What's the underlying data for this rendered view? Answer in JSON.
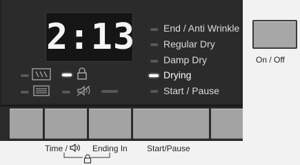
{
  "display": {
    "time": "2:13"
  },
  "status_list": [
    {
      "label": "End / Anti Wrinkle",
      "on": false
    },
    {
      "label": "Regular Dry",
      "on": false
    },
    {
      "label": "Damp Dry",
      "on": false
    },
    {
      "label": "Drying",
      "on": true
    },
    {
      "label": "Start / Pause",
      "on": false
    }
  ],
  "option_icons": [
    {
      "icon": "dry-level-icon",
      "on": false
    },
    {
      "icon": "child-lock-icon",
      "on": true
    },
    {
      "icon": "filter-icon",
      "on": false
    },
    {
      "icon": "sound-off-icon",
      "on": false
    }
  ],
  "buttons": {
    "time_sound_label": "Time /",
    "ending_in_label": "Ending In",
    "start_pause_label": "Start/Pause",
    "lock_combo_icon": "lock-icon"
  },
  "power": {
    "label": "On / Off"
  },
  "colors": {
    "panel": "#2b2b2b",
    "led_on": "#ffffff",
    "led_off": "#585858",
    "key": "#a3a3a3"
  }
}
